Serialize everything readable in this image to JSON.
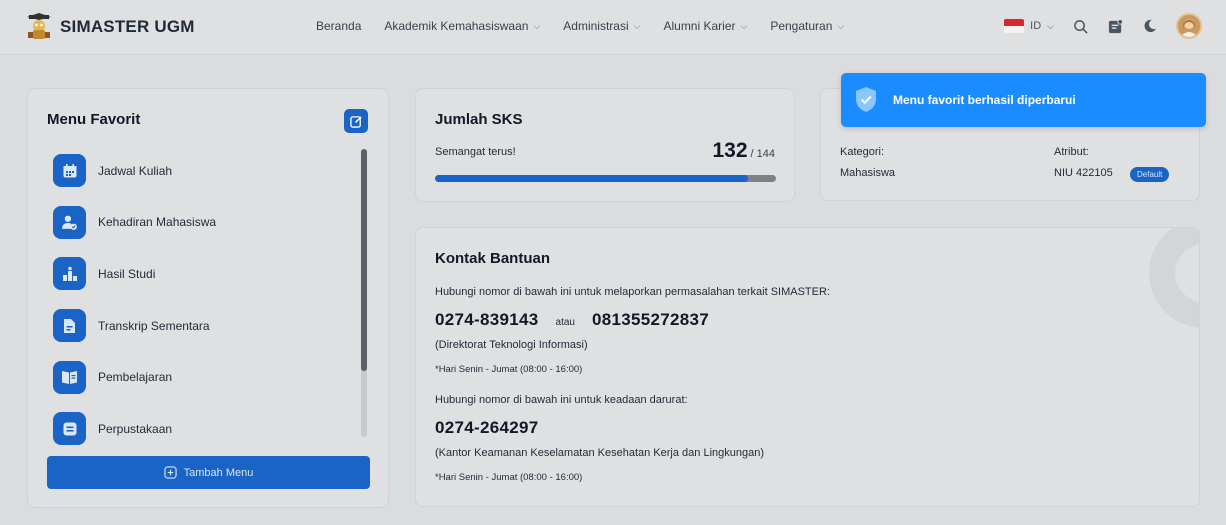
{
  "app": {
    "title": "SIMASTER UGM"
  },
  "nav": {
    "items": [
      {
        "label": "Beranda",
        "has_dropdown": false
      },
      {
        "label": "Akademik Kemahasiswaan",
        "has_dropdown": true
      },
      {
        "label": "Administrasi",
        "has_dropdown": true
      },
      {
        "label": "Alumni Karier",
        "has_dropdown": true
      },
      {
        "label": "Pengaturan",
        "has_dropdown": true
      }
    ]
  },
  "tools": {
    "language": "ID"
  },
  "favorites": {
    "title": "Menu Favorit",
    "items": [
      {
        "label": "Jadwal Kuliah",
        "icon": "calendar-icon"
      },
      {
        "label": "Kehadiran Mahasiswa",
        "icon": "user-check-icon"
      },
      {
        "label": "Hasil Studi",
        "icon": "bar-chart-icon"
      },
      {
        "label": "Transkrip Sementara",
        "icon": "document-icon"
      },
      {
        "label": "Pembelajaran",
        "icon": "book-icon"
      },
      {
        "label": "Perpustakaan",
        "icon": "library-icon"
      }
    ],
    "add_label": "Tambah Menu"
  },
  "sks": {
    "title": "Jumlah SKS",
    "subtitle": "Semangat terus!",
    "current": "132",
    "total": "/ 144",
    "progress": 0.9167
  },
  "category": {
    "kategori_label": "Kategori:",
    "kategori_value": "Mahasiswa",
    "atribut_label": "Atribut:",
    "atribut_value": "NIU 422105",
    "badge": "Default"
  },
  "contact": {
    "title": "Kontak Bantuan",
    "intro": "Hubungi nomor di bawah ini untuk melaporkan permasalahan terkait SIMASTER:",
    "phone1": "0274-839143",
    "or_label": "atau",
    "phone2": "081355272837",
    "org1": "(Direktorat Teknologi Informasi)",
    "hours1": "*Hari Senin - Jumat (08:00 - 16:00)",
    "emergency_intro": "Hubungi nomor di bawah ini untuk keadaan darurat:",
    "phone3": "0274-264297",
    "org2": "(Kantor Keamanan Keselamatan Kesehatan Kerja dan Lingkungan)",
    "hours2": "*Hari Senin - Jumat (08:00 - 16:00)"
  },
  "toast": {
    "message": "Menu favorit berhasil diperbarui"
  },
  "colors": {
    "primary": "#1a64c5",
    "toast": "#1a8cff",
    "flag_red": "#d9262e"
  }
}
